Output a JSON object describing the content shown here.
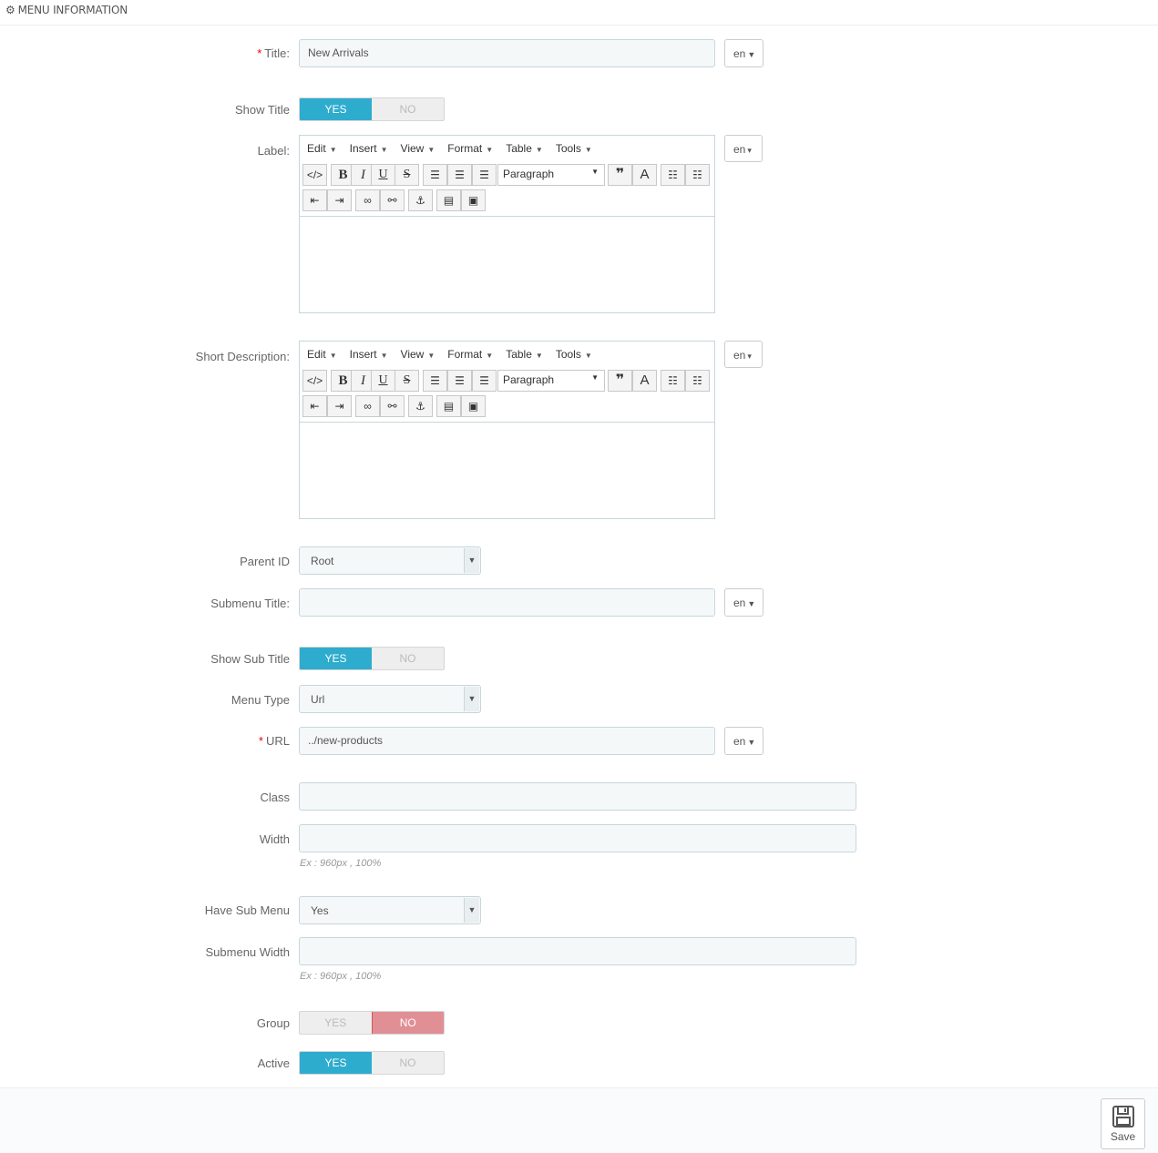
{
  "header": {
    "title": "MENU INFORMATION",
    "icon": "cogs-icon"
  },
  "fields": {
    "title": {
      "label": "Title:",
      "required": "*",
      "value": "New Arrivals",
      "lang": "en"
    },
    "show_title": {
      "label": "Show Title",
      "yes": "YES",
      "no": "NO",
      "state": "yes"
    },
    "label": {
      "label": "Label:",
      "lang": "en"
    },
    "short_description": {
      "label": "Short Description:",
      "lang": "en"
    },
    "parent_id": {
      "label": "Parent ID",
      "value": "Root"
    },
    "submenu_title": {
      "label": "Submenu Title:",
      "value": "",
      "lang": "en"
    },
    "show_sub_title": {
      "label": "Show Sub Title",
      "yes": "YES",
      "no": "NO",
      "state": "yes"
    },
    "menu_type": {
      "label": "Menu Type",
      "value": "Url"
    },
    "url": {
      "label": "URL",
      "required": "*",
      "value": "../new-products",
      "lang": "en"
    },
    "class": {
      "label": "Class",
      "value": ""
    },
    "width": {
      "label": "Width",
      "value": "",
      "help": "Ex : 960px , 100%"
    },
    "have_sub_menu": {
      "label": "Have Sub Menu",
      "value": "Yes"
    },
    "submenu_width": {
      "label": "Submenu Width",
      "value": "",
      "help": "Ex : 960px , 100%"
    },
    "group": {
      "label": "Group",
      "yes": "YES",
      "no": "NO",
      "state": "no"
    },
    "active": {
      "label": "Active",
      "yes": "YES",
      "no": "NO",
      "state": "yes"
    }
  },
  "editor": {
    "menus": [
      "Edit",
      "Insert",
      "View",
      "Format",
      "Table",
      "Tools"
    ],
    "block_format": "Paragraph"
  },
  "footer": {
    "save_label": "Save"
  },
  "colors": {
    "accent": "#2eacce",
    "danger": "#e08f95",
    "input_bg": "#f5f8f9",
    "required": "#ee0000"
  }
}
